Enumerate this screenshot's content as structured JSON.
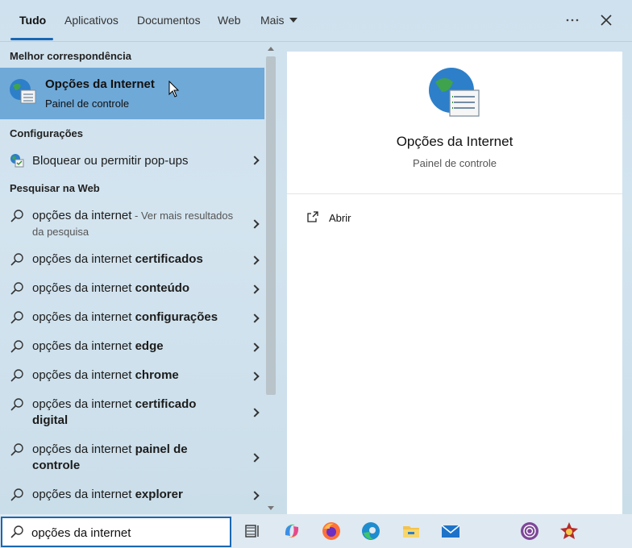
{
  "tabs": [
    {
      "label": "Tudo"
    },
    {
      "label": "Aplicativos"
    },
    {
      "label": "Documentos"
    },
    {
      "label": "Web"
    },
    {
      "label": "Mais"
    }
  ],
  "top_actions": {
    "more_icon": "more-dots-icon",
    "close_icon": "close-icon"
  },
  "best_match": {
    "header": "Melhor correspondência",
    "title": "Opções da Internet",
    "subtitle": "Painel de controle",
    "icon": "internet-options-icon"
  },
  "settings": {
    "header": "Configurações",
    "items": [
      {
        "label": "Bloquear ou permitir pop-ups",
        "icon": "popup-settings-icon"
      }
    ]
  },
  "web": {
    "header": "Pesquisar na Web",
    "first": {
      "query": "opções da internet",
      "hint": " - Ver mais resultados da pesquisa"
    },
    "items": [
      {
        "base": "opções da internet ",
        "bold": "certificados"
      },
      {
        "base": "opções da internet ",
        "bold": "conteúdo"
      },
      {
        "base": "opções da internet ",
        "bold": "configurações"
      },
      {
        "base": "opções da internet ",
        "bold": "edge"
      },
      {
        "base": "opções da internet ",
        "bold": "chrome"
      },
      {
        "base": "opções da internet ",
        "bold": "certificado digital"
      },
      {
        "base": "opções da internet ",
        "bold": "painel de controle"
      },
      {
        "base": "opções da internet ",
        "bold": "explorer"
      }
    ]
  },
  "detail": {
    "title": "Opções da Internet",
    "subtitle": "Painel de controle",
    "actions": [
      {
        "label": "Abrir",
        "icon": "open-icon"
      }
    ]
  },
  "search": {
    "value": "opções da internet",
    "icon": "search-icon"
  },
  "taskbar": {
    "icons": [
      "task-view-icon",
      "copilot-icon",
      "firefox-icon",
      "edge-icon",
      "file-explorer-icon",
      "mail-icon",
      "tor-browser-icon",
      "game-app-icon"
    ]
  },
  "colors": {
    "accent": "#1a67b3",
    "selected_bg": "#6fa9d8",
    "panel_bg": "#ffffff"
  }
}
